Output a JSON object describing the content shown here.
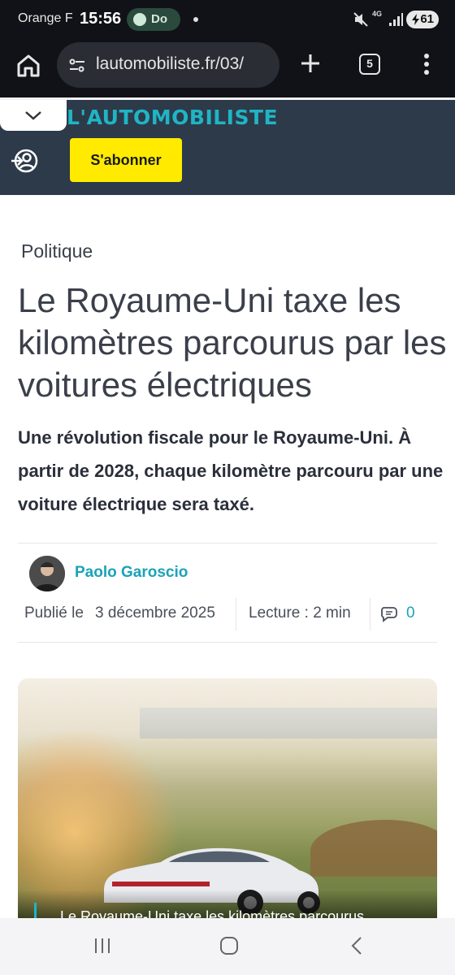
{
  "status_bar": {
    "carrier": "Orange F",
    "time": "15:56",
    "media_app": "Do",
    "network": "4G",
    "battery": "61"
  },
  "browser": {
    "url": "lautomobiliste.fr/03/",
    "tab_count": "5",
    "icons": [
      "home-icon",
      "site-settings-icon",
      "plus-icon",
      "tabs-icon",
      "more-vert-icon"
    ]
  },
  "site": {
    "logo": "L'AUTOMOBILISTE",
    "subscribe_label": "S'abonner",
    "accent_color": "#1fb5c4",
    "header_color": "#2d3a4a",
    "subscribe_color": "#ffea00"
  },
  "article": {
    "category": "Politique",
    "headline": "Le Royaume-Uni taxe les kilomètres parcourus par les voitures électriques",
    "lead": "Une révolution fiscale pour le Royaume-Uni. À partir de 2028, chaque kilomètre parcouru par une voiture électrique sera taxé.",
    "author": "Paolo Garoscio",
    "published_label": "Publié le",
    "published_date": "3 décembre 2025",
    "reading_time": "Lecture : 2 min",
    "comment_count": "0",
    "image_caption": "Le Royaume-Uni taxe les kilomètres parcourus"
  }
}
